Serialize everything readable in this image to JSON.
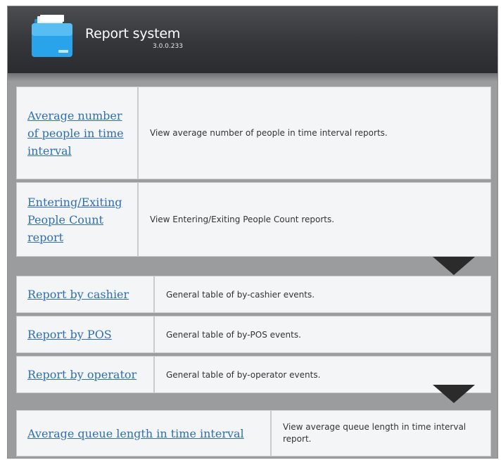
{
  "app": {
    "title": "Report system",
    "version": "3.0.0.233"
  },
  "groups": [
    {
      "reports": [
        {
          "title": "Average number of people in time interval",
          "description": "View average number of people in time interval reports."
        },
        {
          "title": "Entering/Exiting People Count report",
          "description": "View Entering/Exiting People Count reports."
        }
      ]
    },
    {
      "reports": [
        {
          "title": "Report by cashier",
          "description": "General table of by-cashier events."
        },
        {
          "title": "Report by POS",
          "description": "General table of by-POS events."
        },
        {
          "title": "Report by operator",
          "description": "General table of by-operator events."
        }
      ]
    },
    {
      "reports": [
        {
          "title": "Average queue length in time interval",
          "description": "View average queue length in time interval report."
        }
      ]
    }
  ],
  "colors": {
    "link": "#2f6fb4",
    "header": "#36383c",
    "panel": "#9a9c9e",
    "row": "#f4f5f6"
  }
}
